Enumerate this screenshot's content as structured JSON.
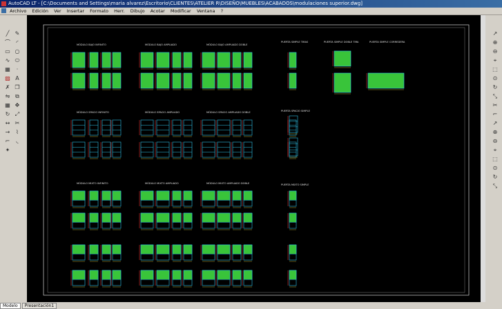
{
  "window": {
    "title": "AutoCAD LT - [C:\\Documents and Settings\\maria alvarez\\Escritorio\\CLIENTES\\ATELIER R\\DISEÑO\\MUEBLES\\ACABADOS\\modulaciones superior.dwg]"
  },
  "menu": [
    "Archivo",
    "Edición",
    "Ver",
    "Insertar",
    "Formato",
    "Herr.",
    "Dibujo",
    "Acotar",
    "Modificar",
    "Ventana",
    "?"
  ],
  "left_tools": [
    "line-icon",
    "pencil-icon",
    "polyline-icon",
    "arc-icon",
    "rectangle-icon",
    "circle-icon",
    "spline-icon",
    "ellipse-icon",
    "block-icon",
    "point-icon",
    "hatch-icon",
    "text-icon",
    "erase-icon",
    "copy-icon",
    "mirror-icon",
    "offset-icon",
    "array-icon",
    "move-icon",
    "rotate-icon",
    "scale-icon",
    "stretch-icon",
    "trim-icon",
    "extend-icon",
    "break-icon",
    "chamfer-icon",
    "fillet-icon",
    "explode-icon"
  ],
  "tabs": [
    "Modelo",
    "Presentación1"
  ],
  "drawing": {
    "rows": [
      {
        "labels": [
          "MÓDULO BAJO INFINITO",
          "MÓDULO BAJO AMPLIADO",
          "MÓDULO BAJO AMPLIADO DOBLE"
        ],
        "style": "full"
      },
      {
        "labels": [],
        "style": "full"
      },
      {
        "labels": [
          "MÓDULO SPACIO INFINITO",
          "MÓDULO SPACIO AMPLIADO",
          "MÓDULO SPACIO AMPLIADO DOBLE"
        ],
        "style": "empty"
      },
      {
        "labels": [],
        "style": "empty"
      },
      {
        "labels": [
          "MÓDULO MIXTO INFINITO",
          "MÓDULO MIXTO AMPLIADO",
          "MÓDULO MIXTO AMPLIADO DOBLE"
        ],
        "style": "mixed"
      },
      {
        "labels": [],
        "style": "mixed"
      },
      {
        "labels": [],
        "style": "mixed"
      },
      {
        "labels": [],
        "style": "mixed"
      }
    ],
    "door_labels": [
      "PUERTA SIMPLE TIRAS",
      "PUERTA SIMPLE DOBLE TIRA",
      "PUERTA SIMPLE CORREDERA",
      "PUERTA SPACIO SIMPLE",
      "PUERTA MIXTO SIMPLE"
    ],
    "colors": {
      "fill": "#39c43a",
      "line": "#2ec4e8",
      "frame": "#d8d8d8",
      "accent": "#e03030",
      "text": "#e0e0e0"
    }
  }
}
